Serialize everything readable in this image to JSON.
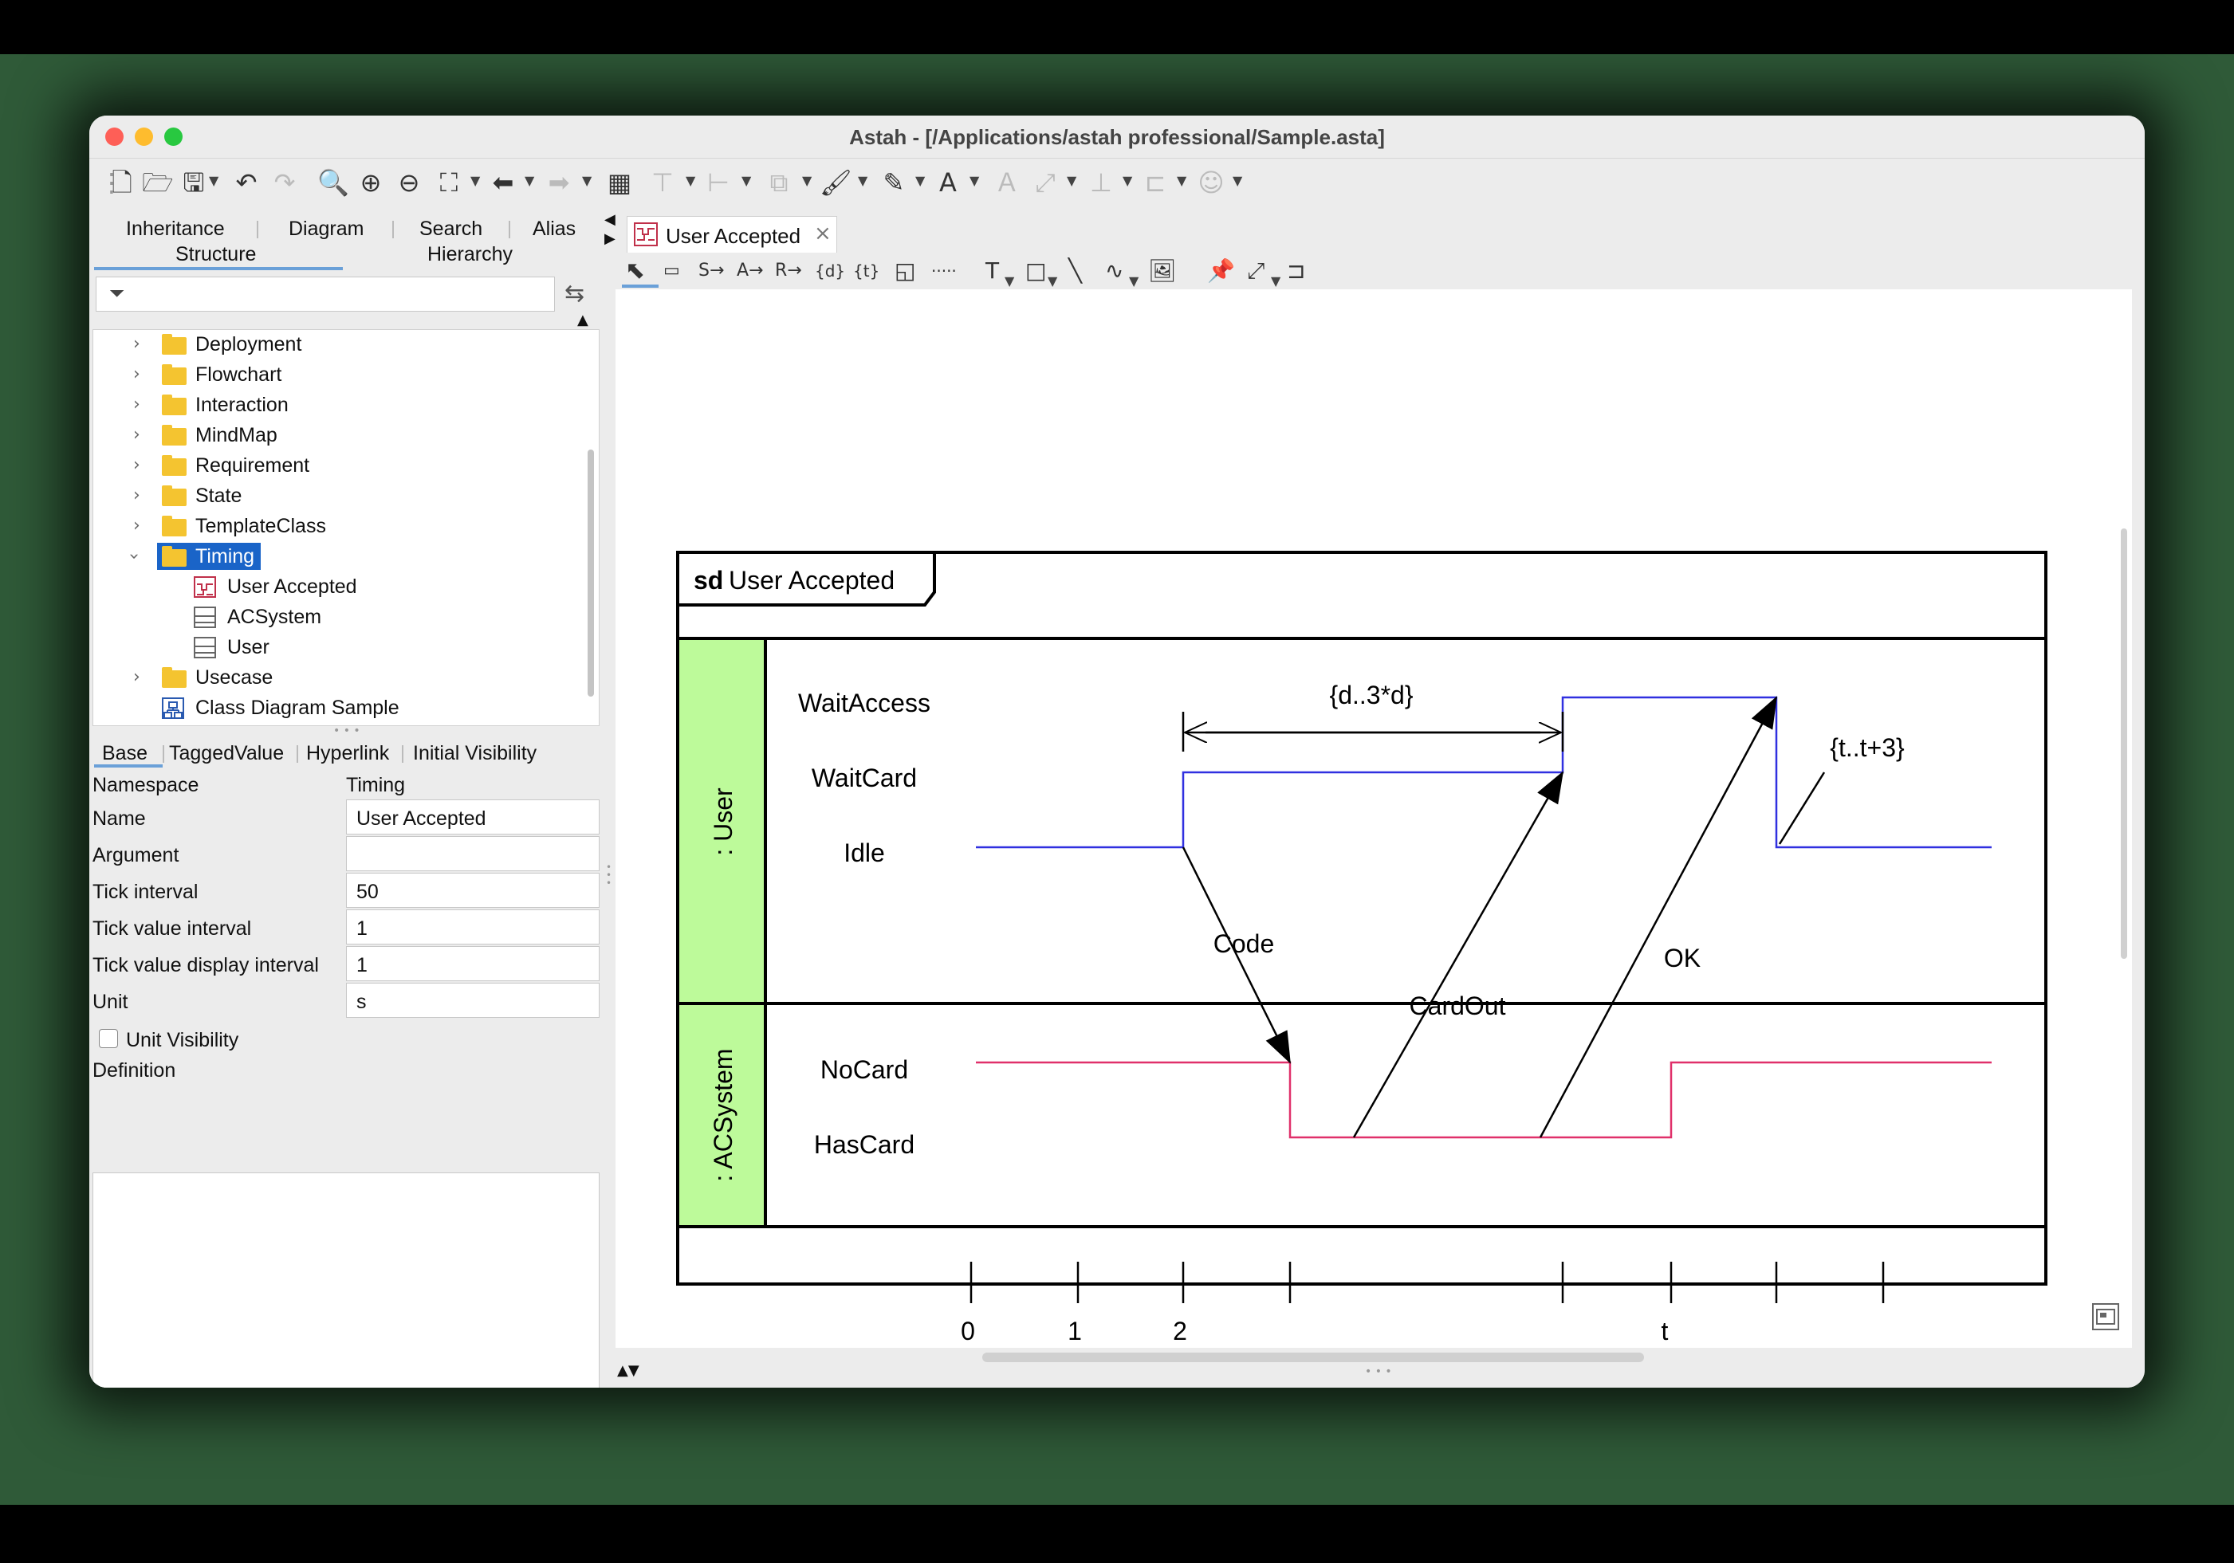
{
  "window": {
    "title": "Astah - [/Applications/astah professional/Sample.asta]"
  },
  "left_panel": {
    "tabs_row1": [
      "Inheritance",
      "Diagram",
      "Search",
      "Alias"
    ],
    "tabs_row2": [
      "Structure",
      "Hierarchy"
    ],
    "filter_placeholder": "",
    "tree": [
      {
        "label": "Deployment",
        "type": "folder",
        "expanded": false
      },
      {
        "label": "Flowchart",
        "type": "folder",
        "expanded": false
      },
      {
        "label": "Interaction",
        "type": "folder",
        "expanded": false
      },
      {
        "label": "MindMap",
        "type": "folder",
        "expanded": false
      },
      {
        "label": "Requirement",
        "type": "folder",
        "expanded": false
      },
      {
        "label": "State",
        "type": "folder",
        "expanded": false
      },
      {
        "label": "TemplateClass",
        "type": "folder",
        "expanded": false
      },
      {
        "label": "Timing",
        "type": "folder",
        "expanded": true,
        "selected": true
      },
      {
        "label": "User Accepted",
        "type": "timing-diagram"
      },
      {
        "label": "ACSystem",
        "type": "class"
      },
      {
        "label": "User",
        "type": "class"
      },
      {
        "label": "Usecase",
        "type": "folder",
        "expanded": false
      },
      {
        "label": "Class Diagram Sample",
        "type": "class-diagram"
      }
    ]
  },
  "properties": {
    "tabs": [
      "Base",
      "TaggedValue",
      "Hyperlink",
      "Initial Visibility"
    ],
    "namespace_label": "Namespace",
    "namespace_value": "Timing",
    "fields": [
      {
        "label": "Name",
        "value": "User Accepted"
      },
      {
        "label": "Argument",
        "value": ""
      },
      {
        "label": "Tick interval",
        "value": "50"
      },
      {
        "label": "Tick value interval",
        "value": "1"
      },
      {
        "label": "Tick value display interval",
        "value": "1"
      },
      {
        "label": "Unit",
        "value": "s"
      }
    ],
    "unit_visibility_label": "Unit Visibility",
    "unit_visibility_checked": false,
    "definition_label": "Definition",
    "definition_value": ""
  },
  "editor": {
    "tab_label": "User Accepted"
  },
  "diagram": {
    "frame_keyword": "sd",
    "frame_name": "User Accepted",
    "lifelines": [
      {
        "name": ": User",
        "color": "#bdfa9a",
        "states": [
          "WaitAccess",
          "WaitCard",
          "Idle"
        ],
        "line_color": "#3030e0"
      },
      {
        "name": ": ACSystem",
        "color": "#bdfa9a",
        "states": [
          "NoCard",
          "HasCard"
        ],
        "line_color": "#e0306a"
      }
    ],
    "messages": [
      "Code",
      "CardOut",
      "OK"
    ],
    "constraints": [
      "{d..3*d}",
      "{t..t+3}"
    ],
    "tick_labels": [
      "0",
      "1",
      "2",
      "t"
    ]
  }
}
